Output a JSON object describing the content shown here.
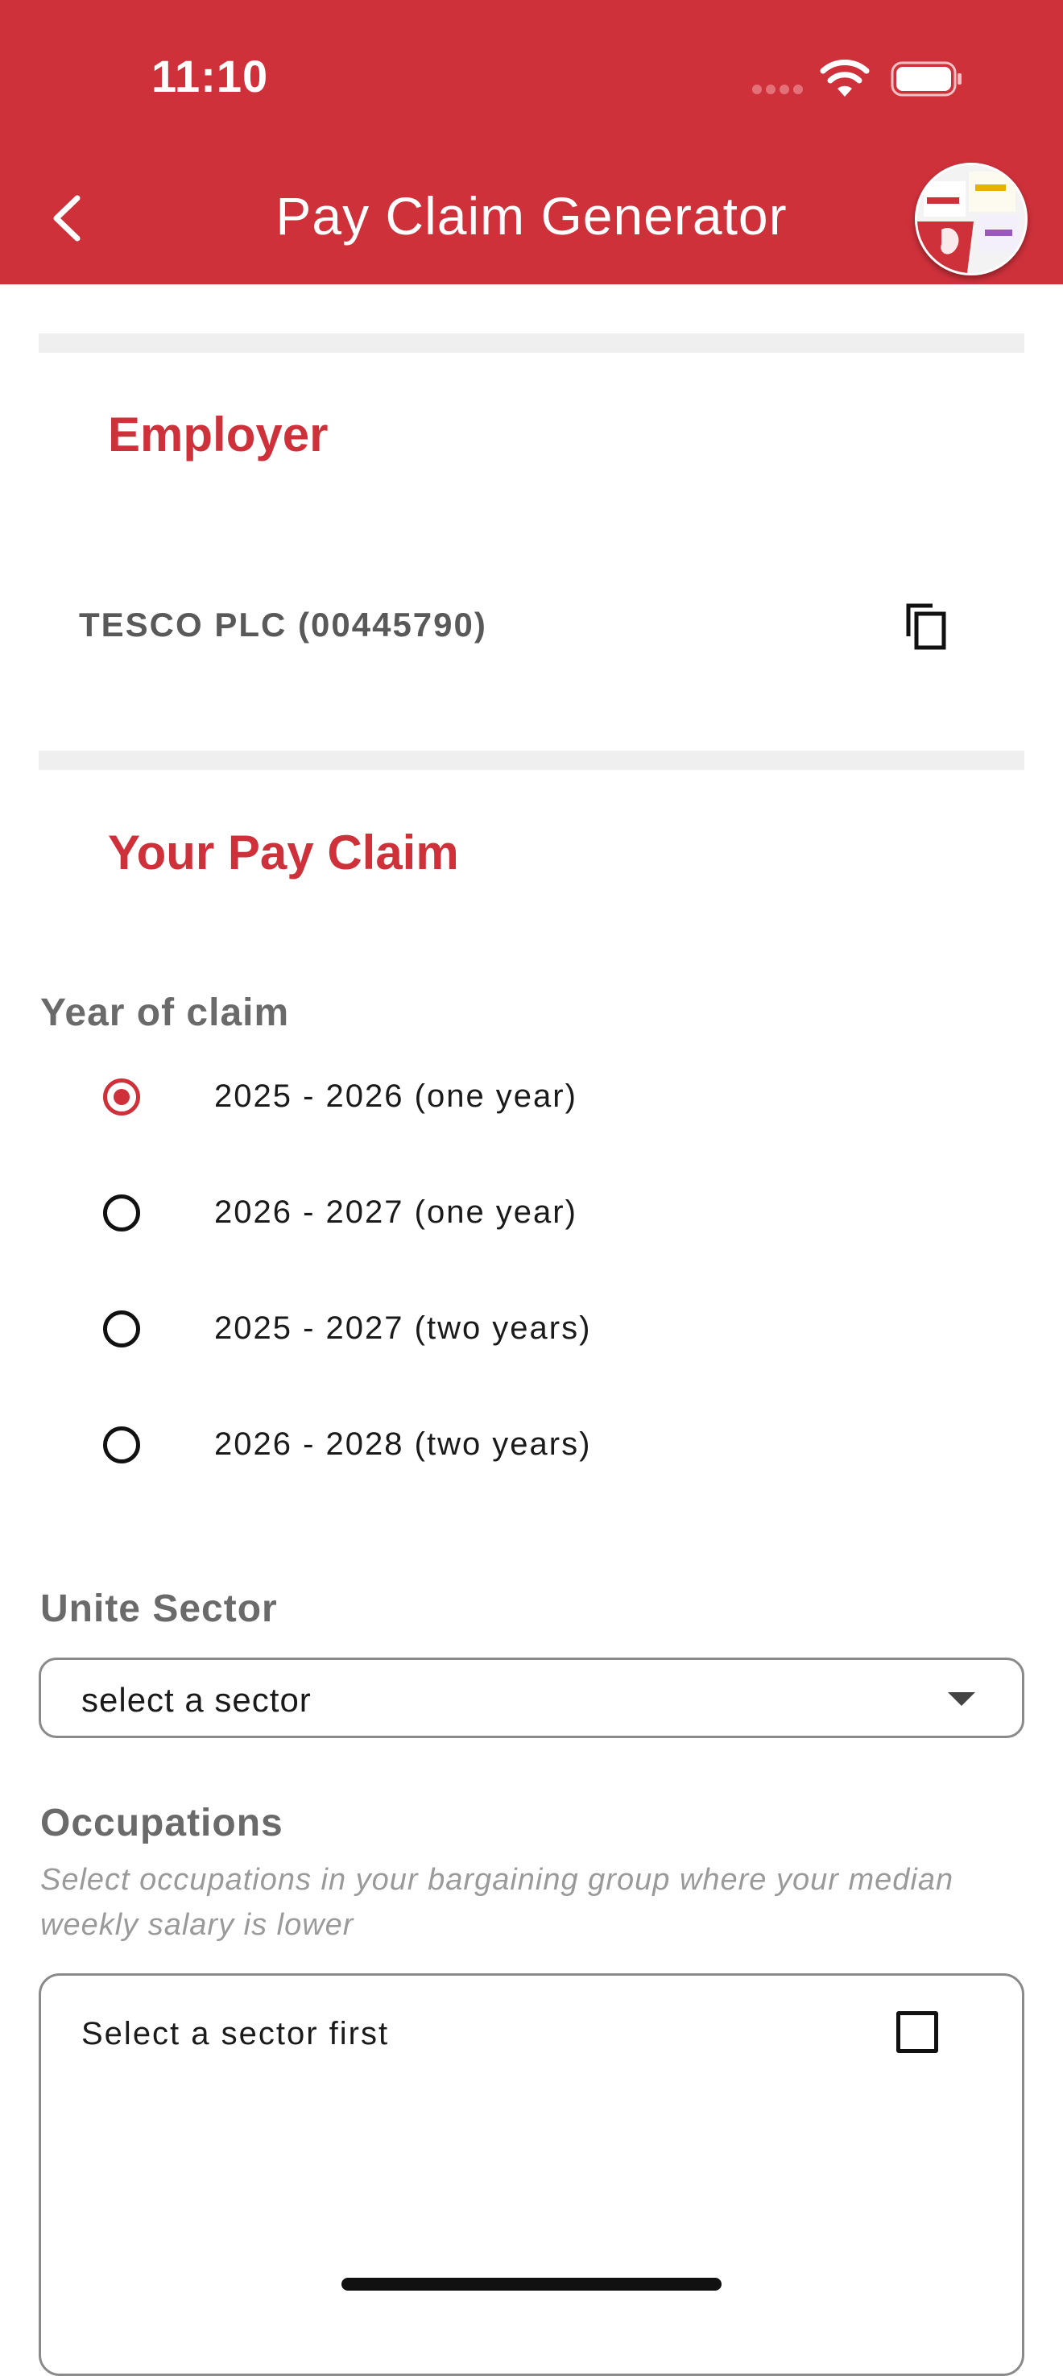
{
  "status_bar": {
    "time": "11:10"
  },
  "header": {
    "title": "Pay Claim Generator",
    "back_icon": "chevron-left-icon",
    "logo": "unite-union-logo"
  },
  "employer": {
    "heading": "Employer",
    "value": "TESCO PLC (00445790)",
    "copy_icon": "copy-icon"
  },
  "pay_claim": {
    "heading": "Your Pay Claim",
    "year_label": "Year of claim",
    "year_options": [
      {
        "label": "2025 - 2026 (one year)",
        "selected": true
      },
      {
        "label": "2026 - 2027 (one year)",
        "selected": false
      },
      {
        "label": "2025 - 2027 (two years)",
        "selected": false
      },
      {
        "label": "2026 - 2028 (two years)",
        "selected": false
      }
    ],
    "sector_label": "Unite Sector",
    "sector_select_value": "select a sector",
    "occupations_label": "Occupations",
    "occupations_hint": "Select occupations in your bargaining group where your median weekly salary is lower",
    "occupations_placeholder": "Select a sector first",
    "occupations_checked": false
  },
  "colors": {
    "brand_red": "#cf313b",
    "divider_gray": "#efefef"
  }
}
